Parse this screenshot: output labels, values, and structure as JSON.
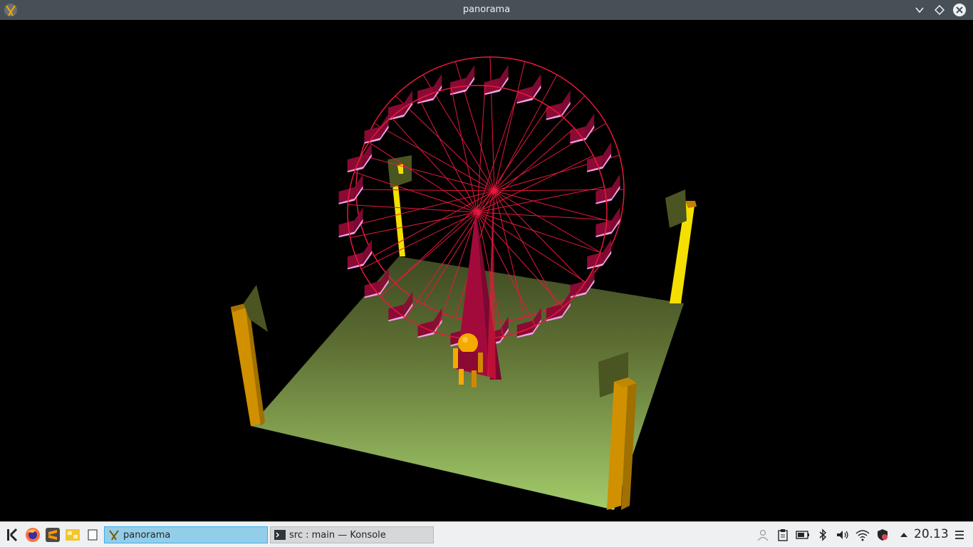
{
  "window": {
    "title": "panorama"
  },
  "taskbar": {
    "tasks": [
      {
        "label": "panorama",
        "active": true
      },
      {
        "label": "src : main — Konsole",
        "active": false
      }
    ],
    "clock": "20.13"
  },
  "scene": {
    "colors": {
      "background": "#000000",
      "ground_far": "#4d5a2a",
      "ground_near": "#a3cc6a",
      "wheel": "#e8183c",
      "cabin": "#8a0a34",
      "cabin_light": "#f0a0e8",
      "tower": "#a30a3c",
      "lamp_post": "#d09000",
      "lamp_post_bright": "#f4e000",
      "lamp_shade": "#4a5522",
      "figure": "#f5aa00"
    },
    "cabin_count": 24,
    "spoke_count": 24
  }
}
